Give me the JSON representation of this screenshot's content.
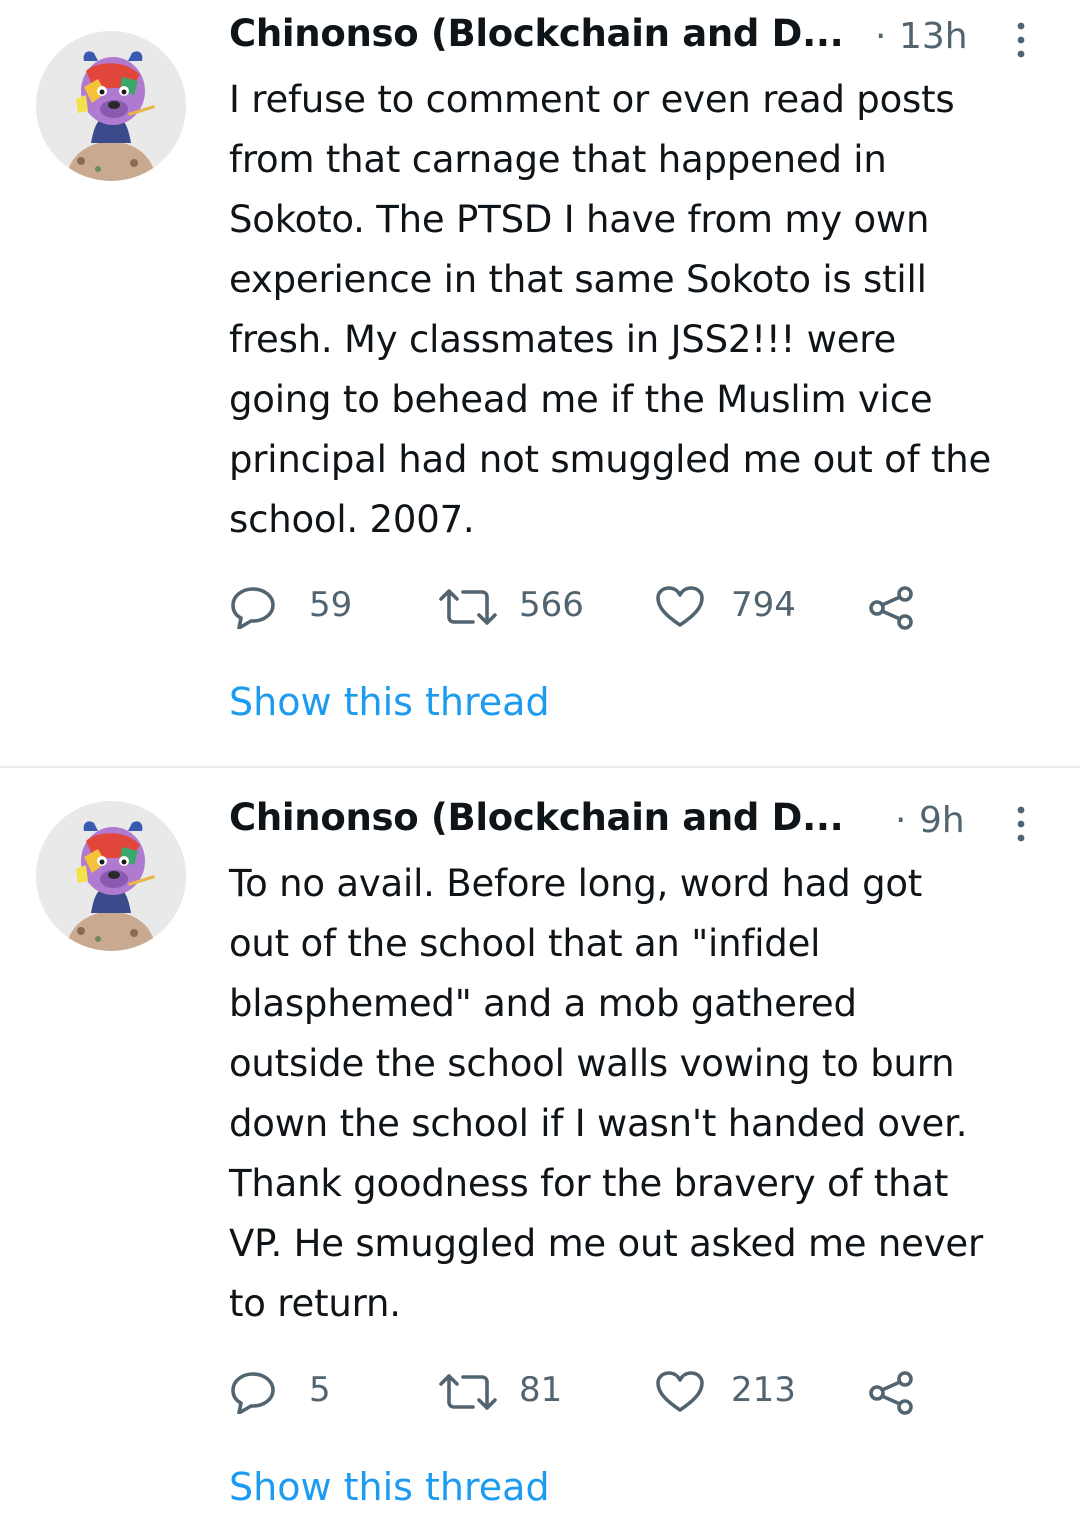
{
  "tweets": [
    {
      "author": "Chinonso (Blockchain and D...",
      "separator": "·",
      "time": "13h",
      "lines": [
        "I refuse to comment or even read posts",
        "from that carnage that happened in",
        "Sokoto. The PTSD I have from my own",
        "experience in that same Sokoto is still",
        "fresh. My classmates in JSS2!!! were",
        "going to behead me if the Muslim vice",
        "principal had not smuggled me out of the",
        "school. 2007."
      ],
      "replies": "59",
      "retweets": "566",
      "likes": "794",
      "show_thread": "Show this thread"
    },
    {
      "author": "Chinonso (Blockchain and D...",
      "separator": "·",
      "time": "9h",
      "lines": [
        "To no avail. Before long, word had got",
        "out of the school that an \"infidel",
        "blasphemed\" and a mob gathered",
        "outside the school walls vowing to burn",
        "down the school if I wasn't handed over.",
        "Thank goodness for the bravery of that",
        "VP. He smuggled me out asked me never",
        "to return."
      ],
      "replies": "5",
      "retweets": "81",
      "likes": "213",
      "show_thread": "Show this thread"
    }
  ],
  "colors": {
    "text": "#0f1419",
    "secondary": "#536471",
    "link": "#1d9bf0",
    "divider": "#e6ecf0",
    "avatar_bg": "#e9e9e9"
  },
  "icons": {
    "reply": "reply-icon",
    "retweet": "retweet-icon",
    "like": "heart-icon",
    "share": "share-icon",
    "more": "more-options-icon"
  }
}
